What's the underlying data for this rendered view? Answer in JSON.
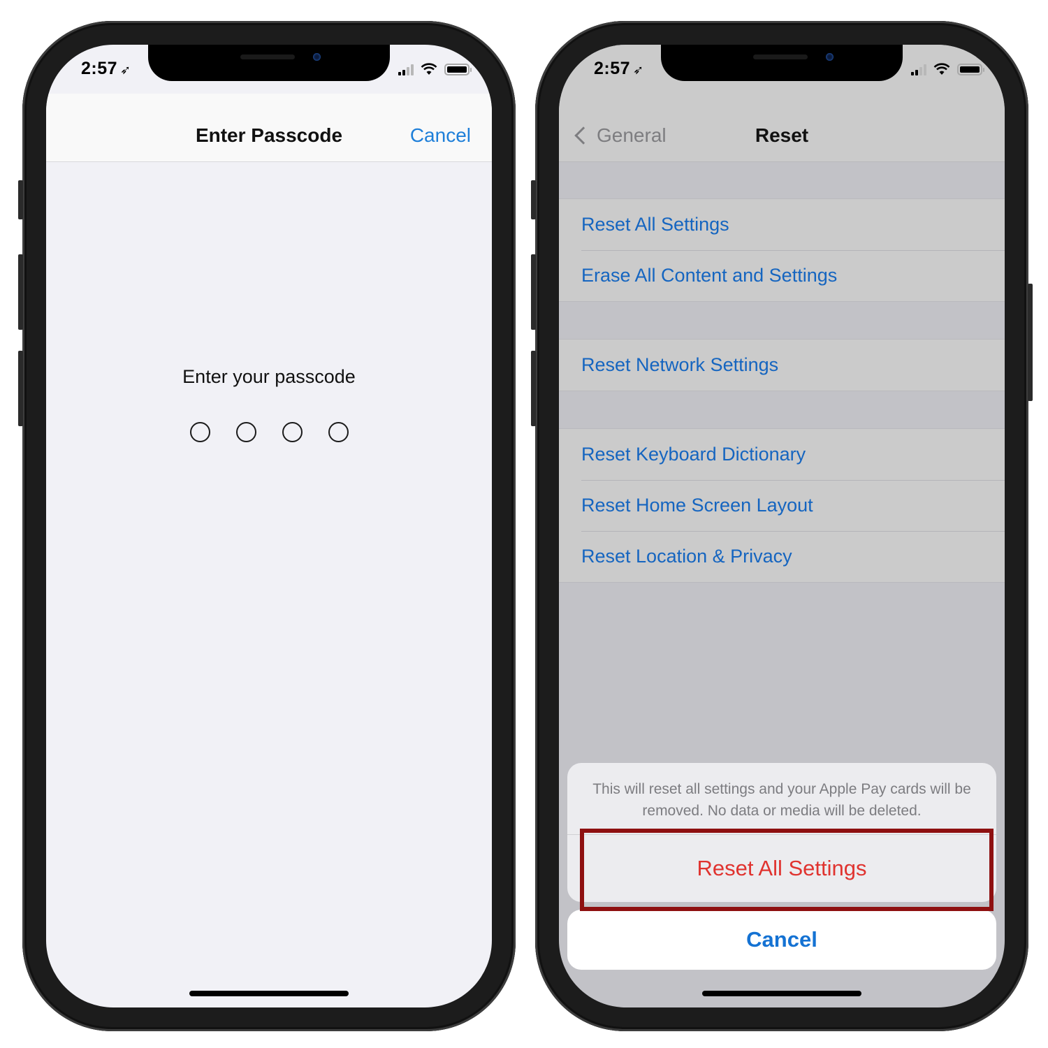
{
  "left_phone": {
    "status_bar": {
      "time": "2:57",
      "location_icon": "location-arrow-icon",
      "signal_icon": "cellular-signal-icon",
      "wifi_icon": "wifi-icon",
      "battery_icon": "battery-icon"
    },
    "navbar": {
      "title": "Enter Passcode",
      "cancel_label": "Cancel"
    },
    "prompt": "Enter your passcode",
    "passcode_length": 4,
    "digits_entered": 0
  },
  "right_phone": {
    "status_bar": {
      "time": "2:57",
      "location_icon": "location-arrow-icon",
      "signal_icon": "cellular-signal-icon",
      "wifi_icon": "wifi-icon",
      "battery_icon": "battery-icon"
    },
    "navbar": {
      "back_label": "General",
      "back_icon": "chevron-left-icon",
      "title": "Reset"
    },
    "groups": [
      {
        "items": [
          {
            "label": "Reset All Settings"
          },
          {
            "label": "Erase All Content and Settings"
          }
        ]
      },
      {
        "items": [
          {
            "label": "Reset Network Settings"
          }
        ]
      },
      {
        "items": [
          {
            "label": "Reset Keyboard Dictionary"
          },
          {
            "label": "Reset Home Screen Layout"
          },
          {
            "label": "Reset Location & Privacy"
          }
        ]
      }
    ],
    "action_sheet": {
      "message": "This will reset all settings and your Apple Pay cards will be removed. No data or media will be deleted.",
      "destructive_label": "Reset All Settings",
      "cancel_label": "Cancel",
      "highlighted": "Reset All Settings"
    }
  },
  "colors": {
    "link_blue": "#1565c0",
    "ios_blue": "#1e7fd9",
    "destructive_red": "#e0332f",
    "highlight_box": "#8e1010"
  }
}
